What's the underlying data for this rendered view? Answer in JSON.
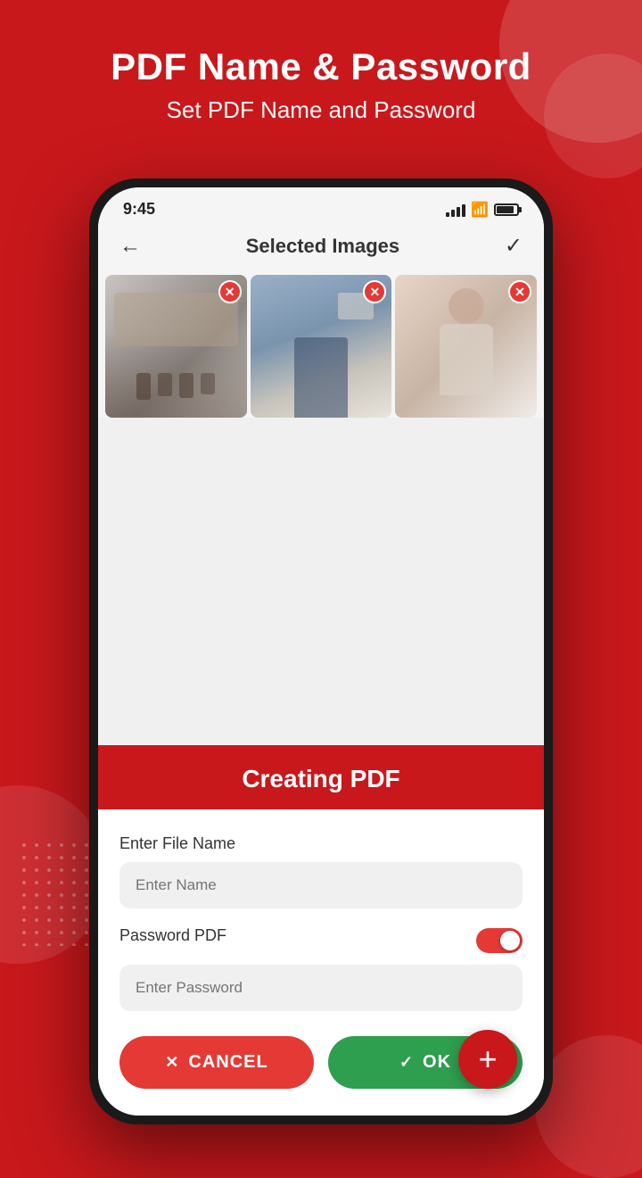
{
  "header": {
    "title": "PDF Name & Password",
    "subtitle": "Set PDF Name and Password"
  },
  "statusBar": {
    "time": "9:45",
    "signal": "strong",
    "wifi": true,
    "battery": 85
  },
  "appBar": {
    "title": "Selected Images",
    "backLabel": "←",
    "checkLabel": "✓"
  },
  "images": [
    {
      "id": 1,
      "alt": "Meeting room with people"
    },
    {
      "id": 2,
      "alt": "Person at computer"
    },
    {
      "id": 3,
      "alt": "Woman smiling"
    }
  ],
  "dialog": {
    "title": "Creating PDF",
    "fileNameLabel": "Enter File Name",
    "fileNamePlaceholder": "Enter Name",
    "passwordLabel": "Password PDF",
    "passwordPlaceholder": "Enter Password",
    "passwordEnabled": true,
    "cancelLabel": "CANCEL",
    "okLabel": "OK"
  },
  "fab": {
    "label": "+"
  },
  "colors": {
    "primary": "#c8181c",
    "success": "#2e9e4f",
    "cancelRed": "#e53935"
  }
}
